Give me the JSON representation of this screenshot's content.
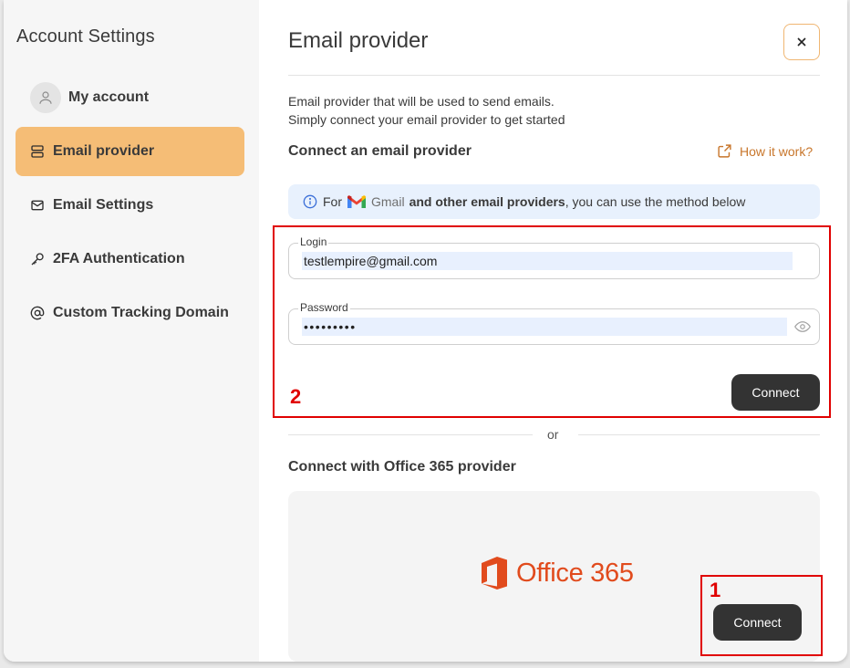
{
  "sidebar": {
    "title": "Account Settings",
    "items": [
      {
        "label": "My account",
        "icon": "user-icon",
        "active": false
      },
      {
        "label": "Email provider",
        "icon": "server-icon",
        "active": true
      },
      {
        "label": "Email Settings",
        "icon": "mail-icon",
        "active": false
      },
      {
        "label": "2FA Authentication",
        "icon": "key-icon",
        "active": false
      },
      {
        "label": "Custom Tracking Domain",
        "icon": "at-icon",
        "active": false
      }
    ]
  },
  "main": {
    "title": "Email provider",
    "description_line1": "Email provider that will be used to send emails.",
    "description_line2": "Simply connect your email provider to get started",
    "connect_section_title": "Connect an email provider",
    "how_link": "How it work?",
    "info_banner": {
      "prefix": "For",
      "gmail_word": "Gmail",
      "bold_text": "and other email providers",
      "suffix": ", you can use the method below"
    },
    "login": {
      "label": "Login",
      "value": "testlempire@gmail.com"
    },
    "password": {
      "label": "Password",
      "value": "•••••••••"
    },
    "connect_button": "Connect",
    "or_text": "or",
    "office_section_title": "Connect with Office 365 provider",
    "office_logo_text": "Office 365",
    "office_connect_button": "Connect"
  },
  "annotations": {
    "box1_number": "1",
    "box2_number": "2"
  },
  "colors": {
    "accent": "#f5bd76",
    "link": "#c8762b",
    "button_dark": "#333333",
    "info_bg": "#e8f1fd",
    "office_red": "#e14b1d",
    "annotation_red": "#e00000"
  }
}
